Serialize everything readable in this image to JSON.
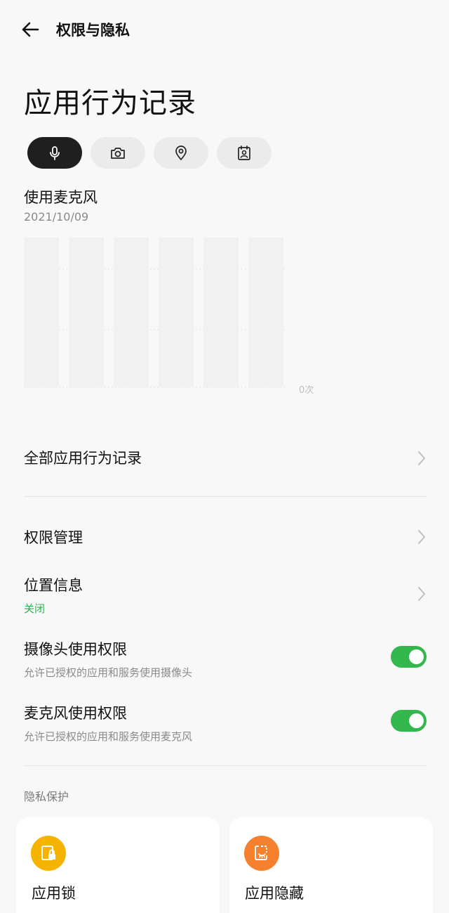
{
  "header": {
    "title": "权限与隐私"
  },
  "page": {
    "title": "应用行为记录"
  },
  "filters": [
    {
      "icon": "microphone-icon",
      "active": true
    },
    {
      "icon": "camera-icon",
      "active": false
    },
    {
      "icon": "location-icon",
      "active": false
    },
    {
      "icon": "contacts-icon",
      "active": false
    }
  ],
  "usage": {
    "label": "使用麦克风",
    "date": "2021/10/09",
    "zero_label": "0次"
  },
  "chart_data": {
    "type": "bar",
    "categories": [
      "",
      "",
      "",
      "",
      "",
      ""
    ],
    "values": [
      0,
      0,
      0,
      0,
      0,
      0
    ],
    "ylabel": "",
    "ylim": [
      0,
      1
    ]
  },
  "list": {
    "all_records": "全部应用行为记录",
    "permission_manage": "权限管理",
    "location": {
      "label": "位置信息",
      "status": "关闭"
    },
    "camera": {
      "label": "摄像头使用权限",
      "desc": "允许已授权的应用和服务使用摄像头",
      "enabled": true
    },
    "mic": {
      "label": "麦克风使用权限",
      "desc": "允许已授权的应用和服务使用麦克风",
      "enabled": true
    }
  },
  "privacy": {
    "title": "隐私保护",
    "cards": [
      {
        "label": "应用锁",
        "color": "#f6b400",
        "icon": "app-lock-icon"
      },
      {
        "label": "应用隐藏",
        "color": "#f5812e",
        "icon": "app-hide-icon"
      }
    ]
  },
  "colors": {
    "accent_green": "#34b84e",
    "status_green": "#2fb04f"
  }
}
